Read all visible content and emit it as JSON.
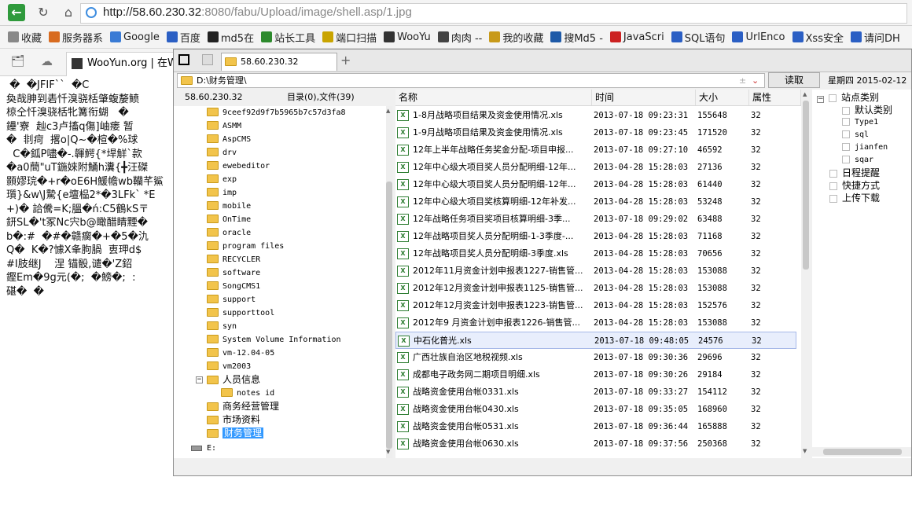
{
  "browser": {
    "url_host": "http://58.60.230.32",
    "url_rest": ":8080/fabu/Upload/image/shell.asp/1.jpg",
    "bookmarks": [
      "收藏",
      "服务器系",
      "Google",
      "百度",
      "md5在",
      "站长工具",
      "端口扫描",
      "WooYu",
      "肉肉 --",
      "我的收藏",
      "搜Md5 -",
      "JavaScri",
      "SQL语句",
      "UrlEnco",
      "Xss安全",
      "请问DH"
    ],
    "tab_title": "WooYun.org | 在W"
  },
  "page": {
    "garbled_lines": [
      " �  �JFIF``  �C",
      "奐哉胂到砉忏溴骁栝肇蝮嫠鲼",
      "椋仝忏溴骁栝牝篝衔蝴   �",
      "鑸'寮  赸c3卢搐q傷]岫瘘 暂",
      "�  剕疴  撂o|Q~�楦�%球",
      "  C�鈲P嚍�-.韗鰐{*垾觧`款",
      "�a0蕳\"uT鍦婡附鯒h瀵{╋汪磔",
      "顥嫪琓�+r�oE6H鰀幨wb韊芊鯊",
      "瓆}&w\\J騺{e壇榀2*�3LFk` *E",
      "+)� 詥儯=K;膃�ń:C5鶴kS〒",
      "鈃SL�'t冢Nc宍b@瞰醋睛黫�",
      "b�:#  �#�赣瘸�+�5�氿",
      "Q�  K�?懅X夆朐腡  叀玾d$",
      "#I肢继J    涅 锚骰,谴�'Z鉊",
      "鏗Em�9g元(�;  �鰟�;  :",
      "碪�  �"
    ]
  },
  "fm": {
    "tab_title": "58.60.230.32",
    "path": "D:\\财务管理\\",
    "read_label": "读取",
    "date_label": "星期四  2015-02-12",
    "host_label": "58.60.230.32",
    "dir_count_label": "目录(0),文件(39)",
    "tree": [
      "9ceef92d9f7b5965b7c57d3fa8",
      "ASMM",
      "AspCMS",
      "drv",
      "ewebeditor",
      "exp",
      "imp",
      "mobile",
      "OnTime",
      "oracle",
      "program files",
      "RECYCLER",
      "software",
      "SongCMS1",
      "support",
      "supporttool",
      "syn",
      "System Volume Information",
      "vm-12.04-05",
      "vm2003"
    ],
    "tree_people": "人员信息",
    "tree_people_child": "notes id",
    "tree_tail": [
      "商务经营管理",
      "市场资料",
      "财务管理"
    ],
    "tree_drive": "E:",
    "columns": {
      "name": "名称",
      "time": "时间",
      "size": "大小",
      "attr": "属性"
    },
    "files": [
      {
        "name": "1-8月战略项目结果及资金使用情况.xls",
        "time": "2013-07-18 09:23:31",
        "size": "155648",
        "attr": "32"
      },
      {
        "name": "1-9月战略项目结果及资金使用情况.xls",
        "time": "2013-07-18 09:23:45",
        "size": "171520",
        "attr": "32"
      },
      {
        "name": "12年上半年战略任务奖金分配-项目申报...",
        "time": "2013-07-18 09:27:10",
        "size": "46592",
        "attr": "32"
      },
      {
        "name": "12年中心级大项目奖人员分配明细-12年...",
        "time": "2013-04-28 15:28:03",
        "size": "27136",
        "attr": "32"
      },
      {
        "name": "12年中心级大项目奖人员分配明细-12年...",
        "time": "2013-04-28 15:28:03",
        "size": "61440",
        "attr": "32"
      },
      {
        "name": "12年中心级大项目奖核算明细-12年补发...",
        "time": "2013-04-28 15:28:03",
        "size": "53248",
        "attr": "32"
      },
      {
        "name": "12年战略任务项目奖项目核算明细-3季...",
        "time": "2013-07-18 09:29:02",
        "size": "63488",
        "attr": "32"
      },
      {
        "name": "12年战略项目奖人员分配明细-1-3季度-...",
        "time": "2013-04-28 15:28:03",
        "size": "71168",
        "attr": "32"
      },
      {
        "name": "12年战略项目奖人员分配明细-3季度.xls",
        "time": "2013-04-28 15:28:03",
        "size": "70656",
        "attr": "32"
      },
      {
        "name": "2012年11月资金计划申报表1227-销售管...",
        "time": "2013-04-28 15:28:03",
        "size": "153088",
        "attr": "32"
      },
      {
        "name": "2012年12月资金计划申报表1125-销售管...",
        "time": "2013-04-28 15:28:03",
        "size": "153088",
        "attr": "32"
      },
      {
        "name": "2012年12月资金计划申报表1223-销售管...",
        "time": "2013-04-28 15:28:03",
        "size": "152576",
        "attr": "32"
      },
      {
        "name": "2012年9 月资金计划申报表1226-销售管...",
        "time": "2013-04-28 15:28:03",
        "size": "153088",
        "attr": "32"
      },
      {
        "name": "中石化普光.xls",
        "time": "2013-07-18 09:48:05",
        "size": "24576",
        "attr": "32"
      },
      {
        "name": "广西壮族自治区地税视频.xls",
        "time": "2013-07-18 09:30:36",
        "size": "29696",
        "attr": "32"
      },
      {
        "name": "成都电子政务网二期项目明细.xls",
        "time": "2013-07-18 09:30:26",
        "size": "29184",
        "attr": "32"
      },
      {
        "name": "战略资金使用台帐0331.xls",
        "time": "2013-07-18 09:33:27",
        "size": "154112",
        "attr": "32"
      },
      {
        "name": "战略资金使用台帐0430.xls",
        "time": "2013-07-18 09:35:05",
        "size": "168960",
        "attr": "32"
      },
      {
        "name": "战略资金使用台帐0531.xls",
        "time": "2013-07-18 09:36:44",
        "size": "165888",
        "attr": "32"
      },
      {
        "name": "战略资金使用台帐0630.xls",
        "time": "2013-07-18 09:37:56",
        "size": "250368",
        "attr": "32"
      }
    ],
    "selected_index": 13,
    "right": {
      "site_types": "站点类别",
      "types": [
        "默认类别",
        "Type1",
        "sql",
        "jianfen",
        "sqar"
      ],
      "schedule": "日程提醒",
      "shortcut": "快捷方式",
      "upload": "上传下载"
    }
  }
}
